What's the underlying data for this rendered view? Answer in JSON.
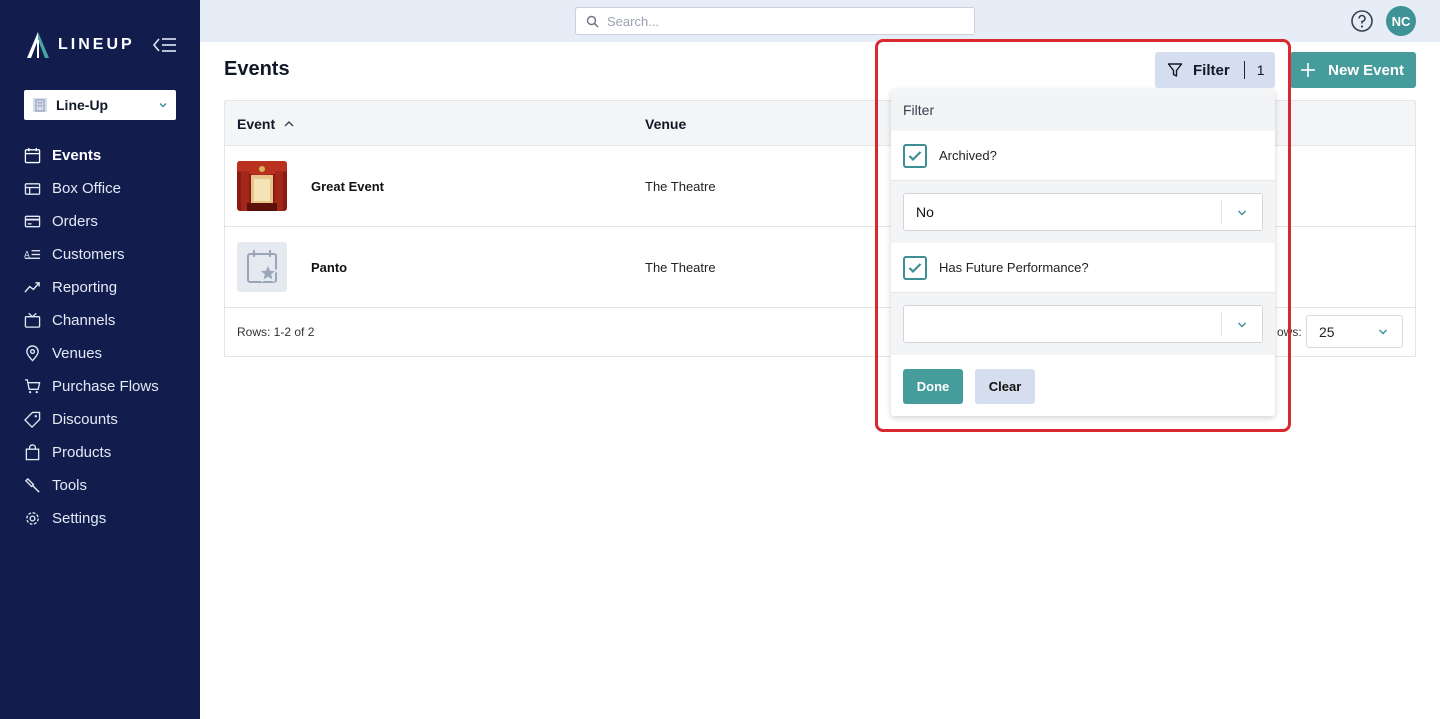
{
  "app": {
    "logo_text": "LINEUP"
  },
  "org_selector": {
    "value": "Line-Up"
  },
  "sidebar": {
    "items": [
      {
        "label": "Events",
        "icon": "calendar-icon",
        "active": true
      },
      {
        "label": "Box Office",
        "icon": "box-office-icon"
      },
      {
        "label": "Orders",
        "icon": "credit-card-icon"
      },
      {
        "label": "Customers",
        "icon": "customers-icon"
      },
      {
        "label": "Reporting",
        "icon": "chart-line-icon"
      },
      {
        "label": "Channels",
        "icon": "tv-icon"
      },
      {
        "label": "Venues",
        "icon": "map-pin-icon"
      },
      {
        "label": "Purchase Flows",
        "icon": "cart-icon"
      },
      {
        "label": "Discounts",
        "icon": "tag-icon"
      },
      {
        "label": "Products",
        "icon": "bag-icon"
      },
      {
        "label": "Tools",
        "icon": "hammer-icon"
      },
      {
        "label": "Settings",
        "icon": "gear-icon"
      }
    ]
  },
  "topbar": {
    "search_placeholder": "Search...",
    "avatar_initials": "NC"
  },
  "page": {
    "title": "Events",
    "new_event_label": "New Event",
    "filter_label": "Filter",
    "filter_count": "1"
  },
  "table": {
    "columns": [
      "Event",
      "Venue"
    ],
    "rows": [
      {
        "name": "Great Event",
        "venue": "The Theatre",
        "thumb": "theatre-image"
      },
      {
        "name": "Panto",
        "venue": "The Theatre",
        "thumb": "calendar-star-placeholder"
      }
    ],
    "rows_count": "Rows: 1-2 of 2",
    "rows_per_page_label": "ows:",
    "rows_per_page": "25"
  },
  "filter_panel": {
    "header": "Filter",
    "archived_label": "Archived?",
    "archived_checked": true,
    "archived_value": "No",
    "future_label": "Has Future Performance?",
    "future_checked": true,
    "future_value": "",
    "done_label": "Done",
    "clear_label": "Clear"
  },
  "colors": {
    "sidebar_bg": "#121d4d",
    "accent": "#469b9b",
    "secondary_button": "#d4deee",
    "highlight": "#d9282f"
  }
}
